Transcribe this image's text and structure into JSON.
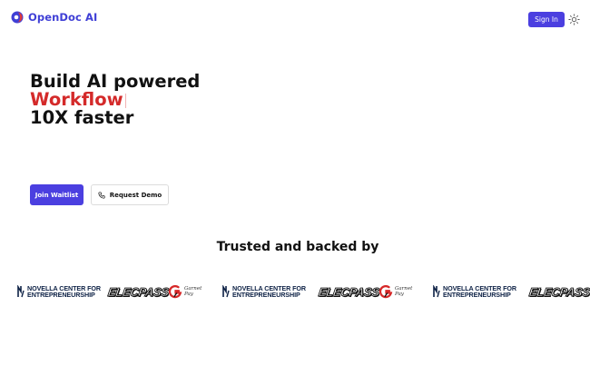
{
  "header": {
    "brand_name": "OpenDoc AI",
    "sign_in_label": "Sign In",
    "brand_colors": {
      "blue": "#3f3fd6",
      "red": "#d42a2a"
    },
    "theme_icon": "sun-icon"
  },
  "hero": {
    "line1": "Build AI powered",
    "line2": "Workflow",
    "line3": "10X faster",
    "accent_color": "#d42a2a"
  },
  "actions": {
    "primary_label": "Join Waitlist",
    "secondary_label": "Request Demo",
    "secondary_icon": "phone-icon",
    "primary_color": "#4b3fe0"
  },
  "trusted": {
    "title": "Trusted and backed by",
    "logos": [
      {
        "kind": "novella",
        "line1": "NOVELLA CENTER FOR",
        "line2": "ENTREPRENEURSHIP"
      },
      {
        "kind": "elecpass",
        "text": "ELECPASS"
      },
      {
        "kind": "garnet",
        "line1": "Garnet",
        "line2": "Pay"
      },
      {
        "kind": "novella",
        "line1": "NOVELLA CENTER FOR",
        "line2": "ENTREPRENEURSHIP"
      },
      {
        "kind": "elecpass",
        "text": "ELECPASS"
      },
      {
        "kind": "garnet",
        "line1": "Garnet",
        "line2": "Pay"
      },
      {
        "kind": "novella",
        "line1": "NOVELLA CENTER FOR",
        "line2": "ENTREPRENEURSHIP"
      },
      {
        "kind": "elecpass",
        "text": "ELECPASS"
      }
    ]
  }
}
